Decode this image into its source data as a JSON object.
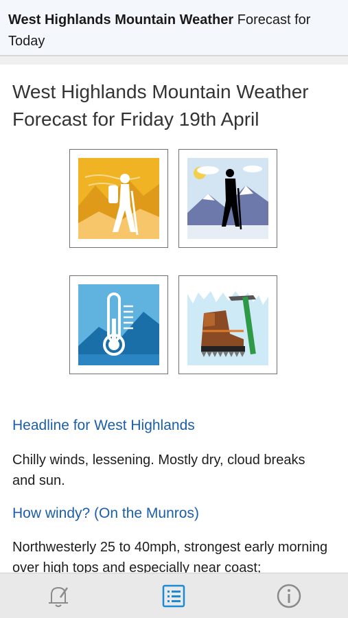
{
  "header": {
    "title_bold": "West Highlands Mountain Weather",
    "title_rest": " Forecast for Today"
  },
  "forecast": {
    "title": "West Highlands Mountain Weather Forecast for Friday 19th April"
  },
  "icons": [
    {
      "name": "hiker-sunny-icon"
    },
    {
      "name": "walker-snowy-mountains-icon"
    },
    {
      "name": "thermometer-mountain-icon"
    },
    {
      "name": "boot-crampon-ice-axe-icon"
    }
  ],
  "sections": [
    {
      "heading": "Headline for West Highlands",
      "text": "Chilly winds, lessening. Mostly dry, cloud breaks and sun."
    },
    {
      "heading": "How windy? (On the Munros)",
      "text": "Northwesterly 25 to 40mph, strongest early morning over high tops and especially near coast;"
    }
  ],
  "bottom_nav": [
    {
      "name": "alert-bell-icon",
      "active": false
    },
    {
      "name": "forecast-list-icon",
      "active": true
    },
    {
      "name": "info-icon",
      "active": false
    }
  ],
  "colors": {
    "link": "#1b5ea8",
    "active_nav": "#1a8ad4",
    "inactive_nav": "#8a8a8a"
  }
}
